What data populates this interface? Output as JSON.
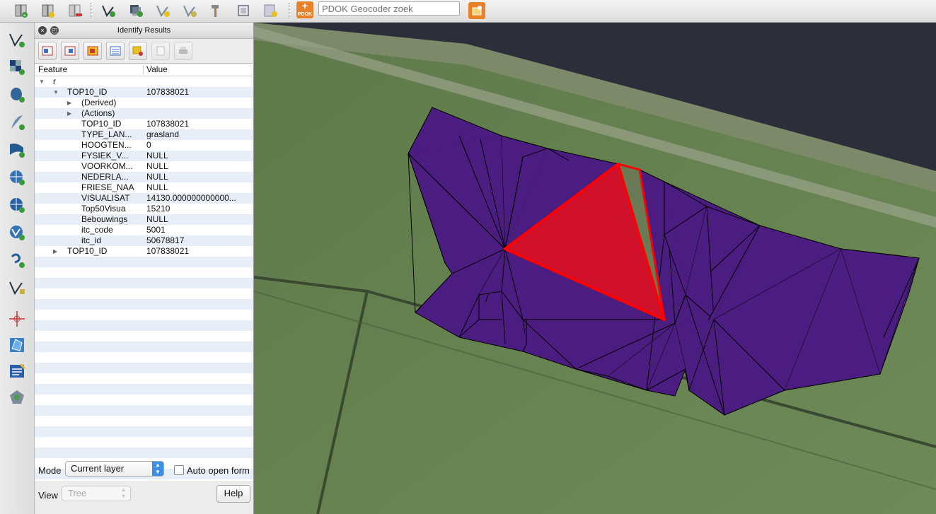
{
  "toolbar": {
    "icons": [
      "new-layer-icon",
      "new-spatialite-icon",
      "remove-layer-icon",
      "add-vector-icon",
      "add-raster-icon",
      "add-postgis-icon",
      "add-wms-icon",
      "hammer-icon",
      "toggle-editing-icon",
      "save-edits-icon",
      "pdok-icon",
      "geocoder-search-icon"
    ],
    "pdok_label": "PDOK",
    "geocoder_placeholder": "PDOK Geocoder zoek"
  },
  "left_toolbar": {
    "icons": [
      "digitize-vertex-icon",
      "add-raster-layer-icon",
      "add-postgis-layer-icon",
      "add-spatialite-icon",
      "add-mssql-icon",
      "add-wms-icon",
      "add-wcs-icon",
      "add-wfs-icon",
      "add-delimited-text-icon",
      "add-gps-icon",
      "capture-crosshair-icon",
      "add-polygon-icon",
      "edit-text-icon",
      "plugin-icon"
    ]
  },
  "panel": {
    "title": "Identify Results",
    "tools": [
      "expand-all-icon",
      "collapse-all-icon",
      "expand-new-icon",
      "clear-results-icon",
      "highlight-icon",
      "copy-icon",
      "print-icon"
    ],
    "columns": {
      "feature": "Feature",
      "value": "Value"
    },
    "rows": [
      {
        "level": 0,
        "arrow": "down",
        "feature": "r",
        "value": ""
      },
      {
        "level": 1,
        "arrow": "down",
        "feature": "TOP10_ID",
        "value": "107838021"
      },
      {
        "level": 2,
        "arrow": "right",
        "feature": "(Derived)",
        "value": ""
      },
      {
        "level": 2,
        "arrow": "right",
        "feature": "(Actions)",
        "value": ""
      },
      {
        "level": 2,
        "arrow": "",
        "feature": "TOP10_ID",
        "value": "107838021"
      },
      {
        "level": 2,
        "arrow": "",
        "feature": "TYPE_LAN...",
        "value": "grasland"
      },
      {
        "level": 2,
        "arrow": "",
        "feature": "HOOGTEN...",
        "value": "0"
      },
      {
        "level": 2,
        "arrow": "",
        "feature": "FYSIEK_V...",
        "value": "NULL"
      },
      {
        "level": 2,
        "arrow": "",
        "feature": "VOORKOM...",
        "value": "NULL"
      },
      {
        "level": 2,
        "arrow": "",
        "feature": "NEDERLA...",
        "value": "NULL"
      },
      {
        "level": 2,
        "arrow": "",
        "feature": "FRIESE_NAA",
        "value": "NULL"
      },
      {
        "level": 2,
        "arrow": "",
        "feature": "VISUALISAT",
        "value": "14130.000000000000..."
      },
      {
        "level": 2,
        "arrow": "",
        "feature": "Top50Visua",
        "value": "15210"
      },
      {
        "level": 2,
        "arrow": "",
        "feature": "Bebouwings",
        "value": "NULL"
      },
      {
        "level": 2,
        "arrow": "",
        "feature": "itc_code",
        "value": "5001"
      },
      {
        "level": 2,
        "arrow": "",
        "feature": "itc_id",
        "value": "50678817"
      },
      {
        "level": 1,
        "arrow": "right",
        "feature": "TOP10_ID",
        "value": "107838021"
      }
    ],
    "mode_label": "Mode",
    "mode_value": "Current layer",
    "auto_open_label": "Auto open form",
    "view_label": "View",
    "view_value": "Tree",
    "help_label": "Help"
  },
  "map": {
    "polygon_fill": "#4b1d80",
    "highlight_fill": "#d0112b",
    "highlight_stroke": "#ff0000"
  }
}
